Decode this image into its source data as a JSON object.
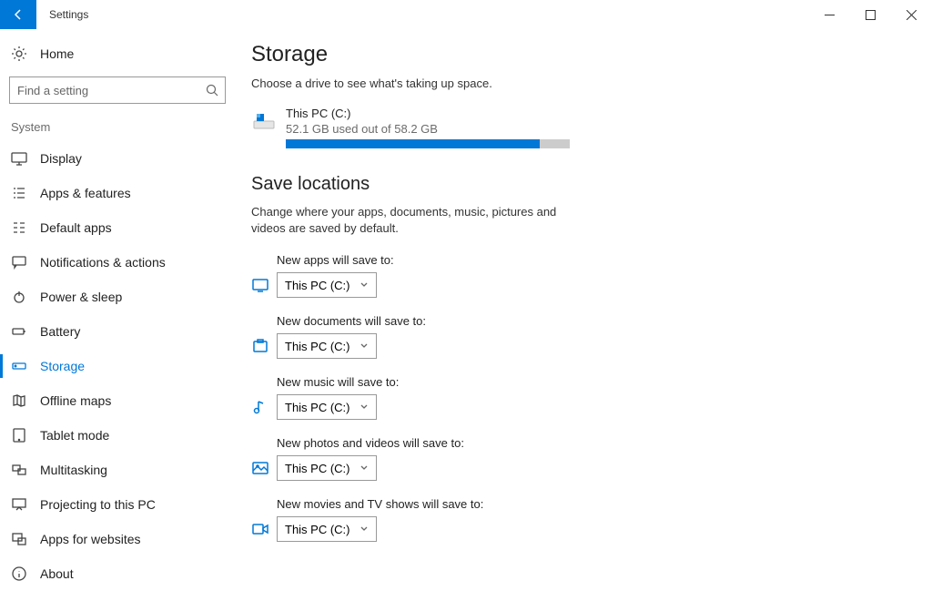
{
  "window": {
    "title": "Settings"
  },
  "sidebar": {
    "home": "Home",
    "search_placeholder": "Find a setting",
    "group": "System",
    "items": [
      {
        "label": "Display"
      },
      {
        "label": "Apps & features"
      },
      {
        "label": "Default apps"
      },
      {
        "label": "Notifications & actions"
      },
      {
        "label": "Power & sleep"
      },
      {
        "label": "Battery"
      },
      {
        "label": "Storage"
      },
      {
        "label": "Offline maps"
      },
      {
        "label": "Tablet mode"
      },
      {
        "label": "Multitasking"
      },
      {
        "label": "Projecting to this PC"
      },
      {
        "label": "Apps for websites"
      },
      {
        "label": "About"
      }
    ]
  },
  "main": {
    "heading": "Storage",
    "subtext": "Choose a drive to see what's taking up space.",
    "drive": {
      "name": "This PC (C:)",
      "used_text": "52.1 GB used out of 58.2 GB",
      "used_gb": 52.1,
      "total_gb": 58.2
    },
    "save_heading": "Save locations",
    "save_desc": "Change where your apps, documents, music, pictures and videos are saved by default.",
    "rows": [
      {
        "label": "New apps will save to:",
        "value": "This PC (C:)"
      },
      {
        "label": "New documents will save to:",
        "value": "This PC (C:)"
      },
      {
        "label": "New music will save to:",
        "value": "This PC (C:)"
      },
      {
        "label": "New photos and videos will save to:",
        "value": "This PC (C:)"
      },
      {
        "label": "New movies and TV shows will save to:",
        "value": "This PC (C:)"
      }
    ]
  }
}
